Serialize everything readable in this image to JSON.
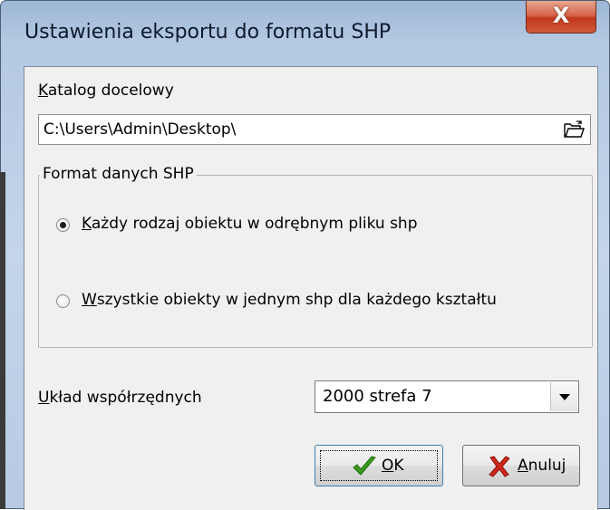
{
  "window": {
    "title": "Ustawienia eksportu do formatu SHP",
    "close_symbol": "X"
  },
  "target_dir": {
    "label_access": "K",
    "label_rest": "atalog docelowy",
    "value": "C:\\Users\\Admin\\Desktop\\",
    "browse_icon": "open-folder-icon"
  },
  "format_group": {
    "legend": "Format danych SHP",
    "options": [
      {
        "access": "K",
        "rest": "ażdy rodzaj obiektu w odrębnym pliku shp",
        "selected": true
      },
      {
        "access": "W",
        "rest": "szystkie obiekty w jednym shp dla każdego kształtu",
        "selected": false
      }
    ]
  },
  "coords": {
    "label_access": "U",
    "label_rest": "kład współrzędnych",
    "selected": "2000 strefa 7"
  },
  "buttons": {
    "ok": {
      "access": "O",
      "rest": "K",
      "icon": "checkmark-icon",
      "icon_color": "#3a9a1e"
    },
    "cancel": {
      "access": "A",
      "rest": "nuluj",
      "icon": "x-icon",
      "icon_color": "#d0261a"
    }
  }
}
